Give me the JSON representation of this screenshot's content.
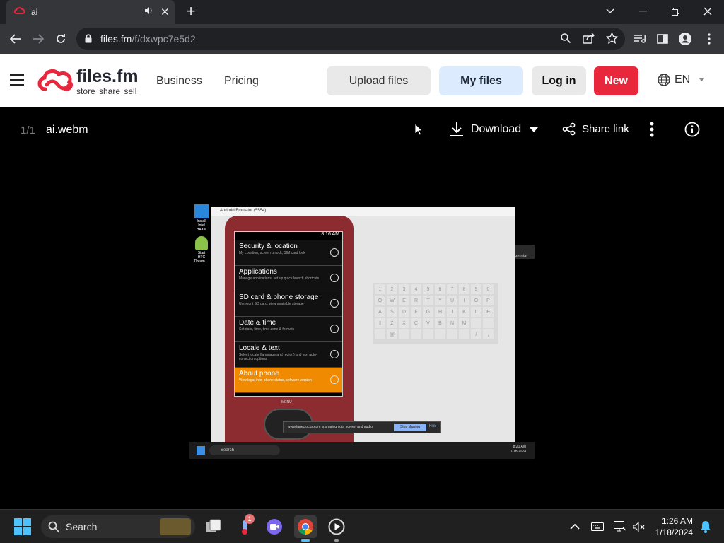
{
  "browser": {
    "tab": {
      "title": "ai"
    },
    "address": {
      "host": "files.fm",
      "path": "/f/dxwpc7e5d2"
    }
  },
  "site": {
    "brand": "files.fm",
    "tagline": "store share sell",
    "nav": {
      "business": "Business",
      "pricing": "Pricing"
    },
    "buttons": {
      "upload": "Upload files",
      "my_files": "My files",
      "login": "Log in",
      "new": "New"
    },
    "lang": "EN",
    "accent": "#e8273c"
  },
  "viewer": {
    "counter": "1/1",
    "filename": "ai.webm",
    "download": "Download",
    "share": "Share link"
  },
  "video": {
    "emulator_title": "Android Emulator (5554)",
    "status_time": "8:16 AM",
    "settings": [
      {
        "title": "Security & location",
        "desc": "My Location, screen unlock, SIM card lock"
      },
      {
        "title": "Applications",
        "desc": "Manage applications, set up quick launch shortcuts"
      },
      {
        "title": "SD card & phone storage",
        "desc": "Unmount SD card, view available storage"
      },
      {
        "title": "Date & time",
        "desc": "Set date, time, time zone & formats"
      },
      {
        "title": "Locale & text",
        "desc": "Select locale (language and region) and text auto-correction options"
      },
      {
        "title": "About phone",
        "desc": "View legal info, phone status, software version"
      }
    ],
    "menu_label": "MENU",
    "keyboard_rows": [
      [
        "1",
        "2",
        "3",
        "4",
        "5",
        "6",
        "7",
        "8",
        "9",
        "0"
      ],
      [
        "Q",
        "W",
        "E",
        "R",
        "T",
        "Y",
        "U",
        "I",
        "O",
        "P"
      ],
      [
        "A",
        "S",
        "D",
        "F",
        "G",
        "H",
        "J",
        "K",
        "L",
        "DEL"
      ],
      [
        "⇧",
        "Z",
        "X",
        "C",
        "V",
        "B",
        "N",
        "M",
        "",
        ""
      ],
      [
        "",
        "@",
        "",
        "",
        "",
        "",
        "",
        "",
        "/",
        ","
      ]
    ],
    "share_notice": "www.tuneclocks.com is sharing your screen and audio.",
    "stop_sharing": "Stop sharing",
    "hide": "Hide",
    "inner_search": "Search",
    "inner_clock_time": "8:21 AM",
    "inner_clock_date": "1/18/2024",
    "desktop_icons": [
      "Install Intel HAXM",
      "Start HTC Dream ..."
    ],
    "terminal_text": "emulat"
  },
  "taskbar": {
    "search": "Search",
    "badge": "1",
    "time": "1:26 AM",
    "date": "1/18/2024"
  }
}
